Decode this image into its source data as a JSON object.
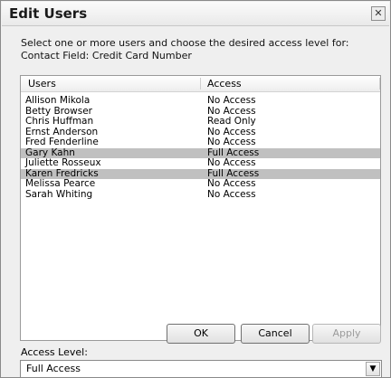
{
  "window": {
    "title": "Edit Users"
  },
  "instructions": "Select one or more users and choose the desired access level for:  Contact Field: Credit Card Number",
  "list": {
    "columns": {
      "users": "Users",
      "access": "Access"
    },
    "rows": [
      {
        "user": "Allison Mikola",
        "access": "No Access",
        "selected": false
      },
      {
        "user": "Betty Browser",
        "access": "No Access",
        "selected": false
      },
      {
        "user": "Chris Huffman",
        "access": "Read Only",
        "selected": false
      },
      {
        "user": "Ernst Anderson",
        "access": "No Access",
        "selected": false
      },
      {
        "user": "Fred Fenderline",
        "access": "No Access",
        "selected": false
      },
      {
        "user": "Gary Kahn",
        "access": "Full Access",
        "selected": true
      },
      {
        "user": "Juliette Rosseux",
        "access": "No Access",
        "selected": false
      },
      {
        "user": "Karen Fredricks",
        "access": "Full Access",
        "selected": true
      },
      {
        "user": "Melissa Pearce",
        "access": "No Access",
        "selected": false
      },
      {
        "user": "Sarah Whiting",
        "access": "No Access",
        "selected": false
      }
    ]
  },
  "access_level": {
    "label": "Access Level:",
    "value": "Full Access"
  },
  "buttons": {
    "ok": "OK",
    "cancel": "Cancel",
    "apply": "Apply"
  },
  "icons": {
    "close": "close-icon",
    "dropdown": "chevron-down-icon"
  }
}
